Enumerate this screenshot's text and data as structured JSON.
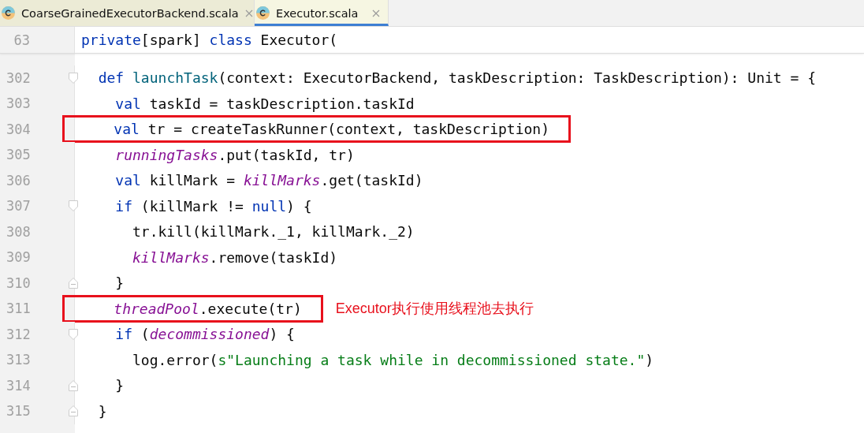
{
  "tabs": [
    {
      "label": "CoarseGrainedExecutorBackend.scala",
      "selected": false
    },
    {
      "label": "Executor.scala",
      "selected": true
    }
  ],
  "sticky_line": {
    "number": "63",
    "tokens": [
      {
        "text": "private",
        "kind": "keyword"
      },
      {
        "text": "[spark] ",
        "kind": "plain"
      },
      {
        "text": "class",
        "kind": "keyword"
      },
      {
        "text": " Executor(",
        "kind": "plain"
      }
    ]
  },
  "lines": [
    {
      "number": "302",
      "kind": "fold_start",
      "boxed": false,
      "tokens": [
        {
          "text": "  def ",
          "kind": "keyword"
        },
        {
          "text": "launchTask",
          "kind": "function"
        },
        {
          "text": "(context: ExecutorBackend, taskDescription: TaskDescription): Unit = {",
          "kind": "plain"
        }
      ]
    },
    {
      "number": "303",
      "kind": "plain",
      "boxed": false,
      "tokens": [
        {
          "text": "    val",
          "kind": "keyword"
        },
        {
          "text": " taskId = taskDescription.taskId",
          "kind": "plain"
        }
      ]
    },
    {
      "number": "304",
      "kind": "plain",
      "boxed": true,
      "tokens": [
        {
          "text": "    val",
          "kind": "keyword"
        },
        {
          "text": " tr = createTaskRunner(context, taskDescription)",
          "kind": "plain"
        }
      ]
    },
    {
      "number": "305",
      "kind": "plain",
      "boxed": false,
      "tokens": [
        {
          "text": "    runningTasks",
          "kind": "field"
        },
        {
          "text": ".put(taskId, tr)",
          "kind": "plain"
        }
      ]
    },
    {
      "number": "306",
      "kind": "plain",
      "boxed": false,
      "tokens": [
        {
          "text": "    val",
          "kind": "keyword"
        },
        {
          "text": " killMark = ",
          "kind": "plain"
        },
        {
          "text": "killMarks",
          "kind": "field"
        },
        {
          "text": ".get(taskId)",
          "kind": "plain"
        }
      ]
    },
    {
      "number": "307",
      "kind": "fold_start",
      "boxed": false,
      "tokens": [
        {
          "text": "    if",
          "kind": "keyword"
        },
        {
          "text": " (killMark != ",
          "kind": "plain"
        },
        {
          "text": "null",
          "kind": "keyword"
        },
        {
          "text": ") {",
          "kind": "plain"
        }
      ]
    },
    {
      "number": "308",
      "kind": "plain",
      "boxed": false,
      "tokens": [
        {
          "text": "      tr.kill(killMark._1, killMark._2)",
          "kind": "plain"
        }
      ]
    },
    {
      "number": "309",
      "kind": "plain",
      "boxed": false,
      "tokens": [
        {
          "text": "      killMarks",
          "kind": "field"
        },
        {
          "text": ".remove(taskId)",
          "kind": "plain"
        }
      ]
    },
    {
      "number": "310",
      "kind": "fold_end",
      "boxed": false,
      "tokens": [
        {
          "text": "    }",
          "kind": "plain"
        }
      ]
    },
    {
      "number": "311",
      "kind": "plain",
      "boxed": true,
      "note": "Executor执行使用线程池去执行",
      "tokens": [
        {
          "text": "    threadPool",
          "kind": "field"
        },
        {
          "text": ".execute(tr)",
          "kind": "plain"
        }
      ]
    },
    {
      "number": "312",
      "kind": "fold_start",
      "boxed": false,
      "tokens": [
        {
          "text": "    if",
          "kind": "keyword"
        },
        {
          "text": " (",
          "kind": "plain"
        },
        {
          "text": "decommissioned",
          "kind": "field"
        },
        {
          "text": ") {",
          "kind": "plain"
        }
      ]
    },
    {
      "number": "313",
      "kind": "plain",
      "boxed": false,
      "tokens": [
        {
          "text": "      log.error(",
          "kind": "plain"
        },
        {
          "text": "s\"Launching a task while in decommissioned state.\"",
          "kind": "string"
        },
        {
          "text": ")",
          "kind": "plain"
        }
      ]
    },
    {
      "number": "314",
      "kind": "fold_end",
      "boxed": false,
      "tokens": [
        {
          "text": "    }",
          "kind": "plain"
        }
      ]
    },
    {
      "number": "315",
      "kind": "fold_end",
      "boxed": false,
      "tokens": [
        {
          "text": "  }",
          "kind": "plain"
        }
      ]
    }
  ]
}
